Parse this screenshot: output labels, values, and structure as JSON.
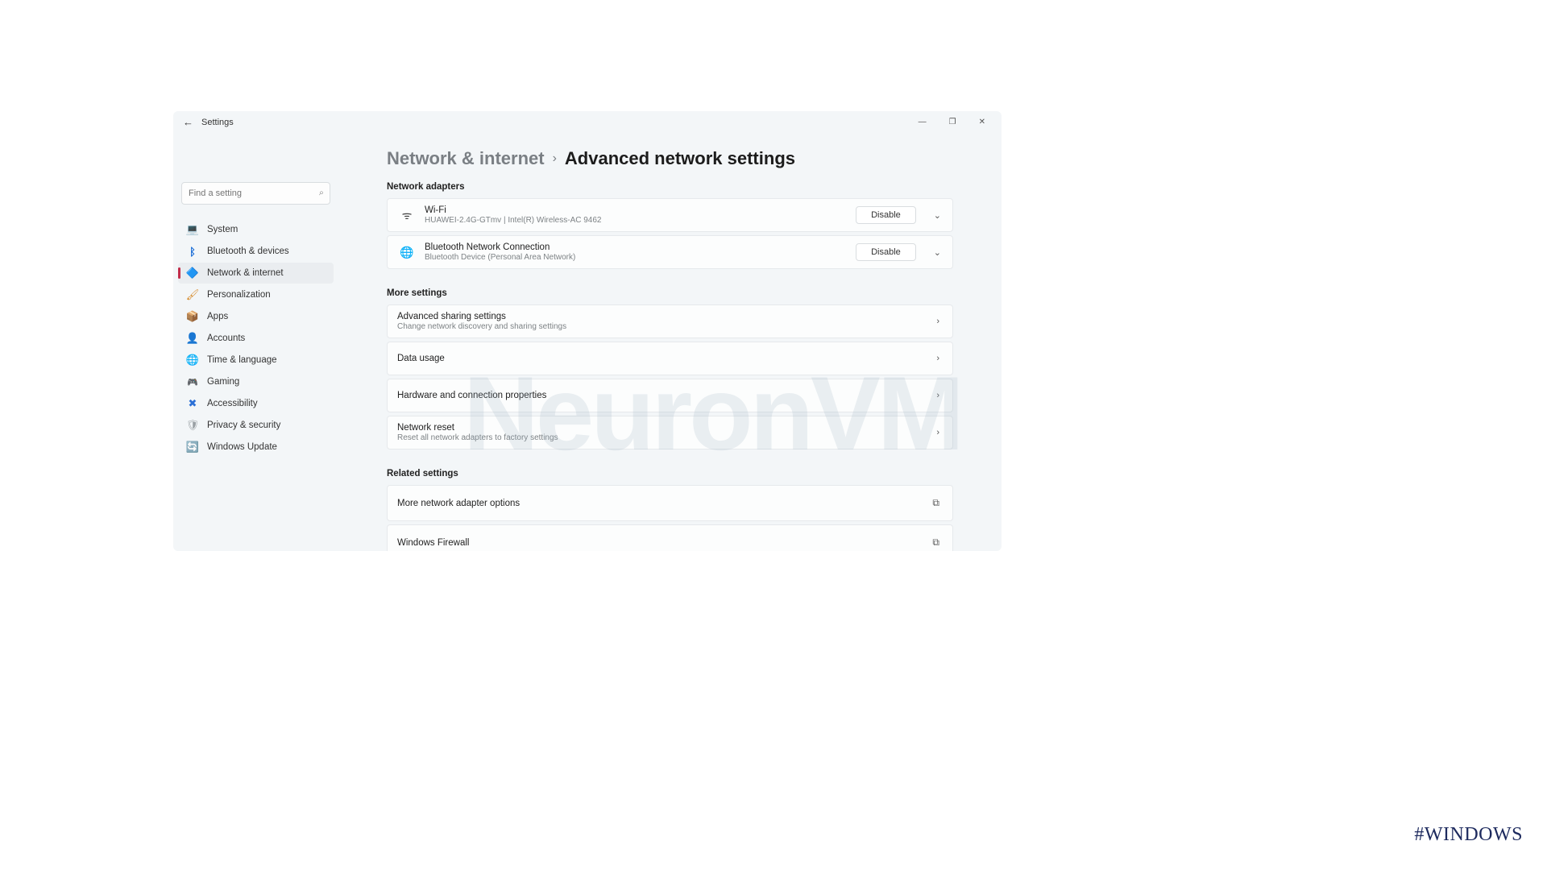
{
  "window": {
    "back_arrow": "←",
    "title": "Settings",
    "controls": {
      "minimize": "—",
      "maximize": "❐",
      "close": "✕"
    }
  },
  "search": {
    "placeholder": "Find a setting",
    "icon_glyph": "⌕"
  },
  "sidebar": {
    "items": [
      {
        "label": "System",
        "icon": "💻"
      },
      {
        "label": "Bluetooth & devices",
        "icon": "ᛒ"
      },
      {
        "label": "Network & internet",
        "icon": "🔷"
      },
      {
        "label": "Personalization",
        "icon": "🖌"
      },
      {
        "label": "Apps",
        "icon": "📦"
      },
      {
        "label": "Accounts",
        "icon": "👤"
      },
      {
        "label": "Time & language",
        "icon": "🌐"
      },
      {
        "label": "Gaming",
        "icon": "🎮"
      },
      {
        "label": "Accessibility",
        "icon": "✖"
      },
      {
        "label": "Privacy & security",
        "icon": "🛡"
      },
      {
        "label": "Windows Update",
        "icon": "🔄"
      }
    ]
  },
  "breadcrumb": {
    "parent": "Network & internet",
    "sep": "›",
    "current": "Advanced network settings"
  },
  "sections": {
    "network_adapters": {
      "header": "Network adapters",
      "items": [
        {
          "icon": "ᯤ",
          "title": "Wi-Fi",
          "subtitle": "HUAWEI-2.4G-GTmv | Intel(R) Wireless-AC 9462",
          "button": "Disable",
          "chevron": "⌄"
        },
        {
          "icon": "🌐",
          "title": "Bluetooth Network Connection",
          "subtitle": "Bluetooth Device (Personal Area Network)",
          "button": "Disable",
          "chevron": "⌄"
        }
      ]
    },
    "more_settings": {
      "header": "More settings",
      "items": [
        {
          "title": "Advanced sharing settings",
          "subtitle": "Change network discovery and sharing settings",
          "chevron": "›"
        },
        {
          "title": "Data usage",
          "chevron": "›"
        },
        {
          "title": "Hardware and connection properties",
          "chevron": "›"
        },
        {
          "title": "Network reset",
          "subtitle": "Reset all network adapters to factory settings",
          "chevron": "›"
        }
      ]
    },
    "related": {
      "header": "Related settings",
      "items": [
        {
          "title": "More network adapter options",
          "link_glyph": "⧉"
        },
        {
          "title": "Windows Firewall",
          "link_glyph": "⧉"
        }
      ]
    }
  },
  "hashtag": "#WINDOWS",
  "watermark": "NeuronVM"
}
